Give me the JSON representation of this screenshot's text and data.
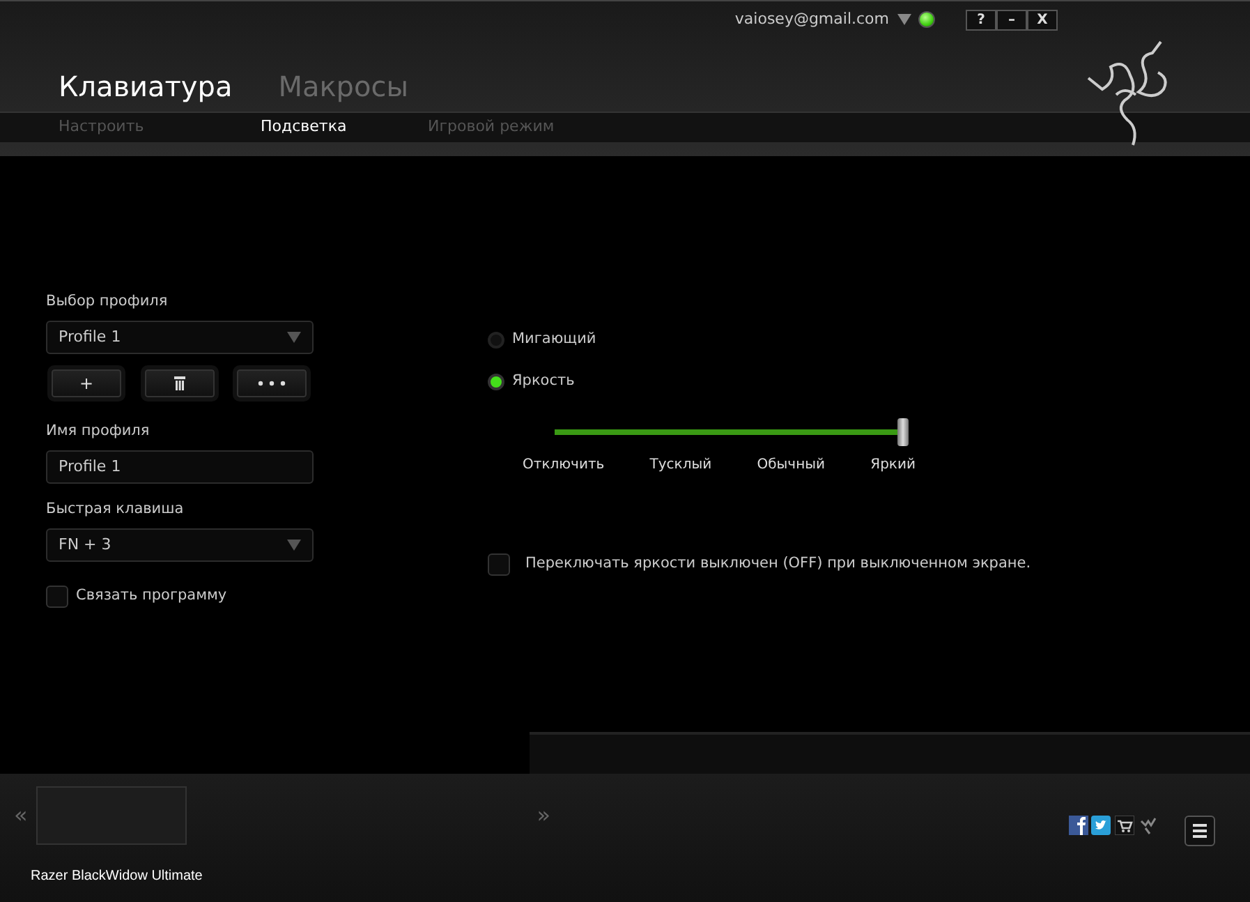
{
  "window": {
    "account": "vaiosey@gmail.com",
    "online": true,
    "controls": [
      {
        "label": "?"
      },
      {
        "label": "–"
      },
      {
        "label": "X"
      }
    ]
  },
  "tabs": [
    {
      "label": "Клавиатура",
      "selected": true
    },
    {
      "label": "Макросы",
      "selected": false
    }
  ],
  "subtabs": [
    {
      "label": "Настроить",
      "selected": false
    },
    {
      "label": "Подсветка",
      "selected": true
    },
    {
      "label": "Игровой режим",
      "selected": false
    }
  ],
  "profile": {
    "label": "Выбор профиля",
    "value": "Profile 1",
    "buttons": [
      {
        "kind": "add",
        "label": "+"
      },
      {
        "kind": "delete"
      },
      {
        "kind": "more"
      }
    ]
  },
  "profile_name": {
    "label": "Имя профиля",
    "value": "Profile 1"
  },
  "hotkey": {
    "label": "Быстрая клавиша",
    "value": "FN + 3"
  },
  "link_program": {
    "label": "Связать программу",
    "checked": false
  },
  "effects": [
    {
      "label": "Мигающий",
      "selected": false
    },
    {
      "label": "Яркость",
      "selected": true
    }
  ],
  "brightness": {
    "level": 1,
    "ticks": [
      "Отключить",
      "Тусклый",
      "Обычный",
      "Яркий"
    ]
  },
  "screen_off": {
    "label": "Переключать яркости выключен (OFF) при выключенном экране.",
    "checked": false
  },
  "device": {
    "prev": "«",
    "name": "Razer BlackWidow Ultimate",
    "next": "»"
  },
  "footer": {
    "links": [
      {
        "kind": "facebook"
      },
      {
        "kind": "twitter"
      },
      {
        "kind": "cart"
      },
      {
        "kind": "logo"
      }
    ]
  }
}
